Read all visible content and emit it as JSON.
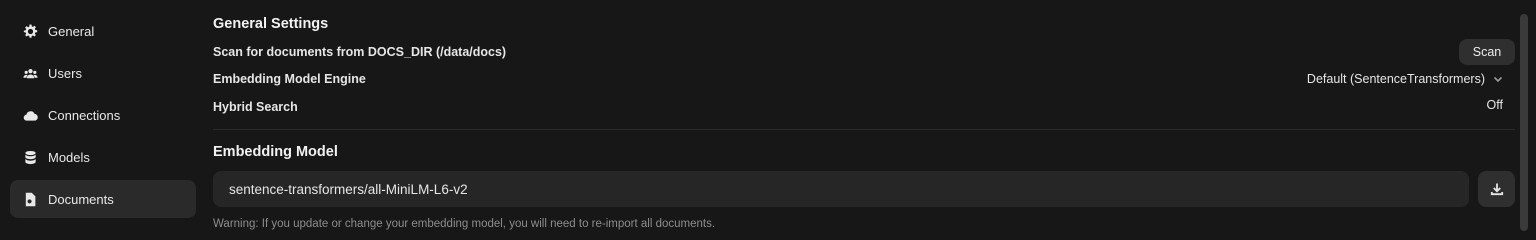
{
  "sidebar": {
    "items": [
      {
        "label": "General",
        "icon": "gear-icon",
        "active": false
      },
      {
        "label": "Users",
        "icon": "users-icon",
        "active": false
      },
      {
        "label": "Connections",
        "icon": "cloud-icon",
        "active": false
      },
      {
        "label": "Models",
        "icon": "database-icon",
        "active": false
      },
      {
        "label": "Documents",
        "icon": "document-icon",
        "active": true
      }
    ]
  },
  "general_settings": {
    "title": "General Settings",
    "scan_label": "Scan for documents from DOCS_DIR (/data/docs)",
    "scan_button": "Scan",
    "engine_label": "Embedding Model Engine",
    "engine_value": "Default (SentenceTransformers)",
    "hybrid_label": "Hybrid Search",
    "hybrid_value": "Off"
  },
  "embedding_model": {
    "title": "Embedding Model",
    "input_value": "sentence-transformers/all-MiniLM-L6-v2",
    "download_icon": "download-icon",
    "warning": "Warning: If you update or change your embedding model, you will need to re-import all documents."
  },
  "colors": {
    "background": "#171717",
    "active_item": "#2a2a2a",
    "input_bg": "#262626",
    "button_bg": "#2f2f2f",
    "muted_text": "#8d8d8d"
  }
}
